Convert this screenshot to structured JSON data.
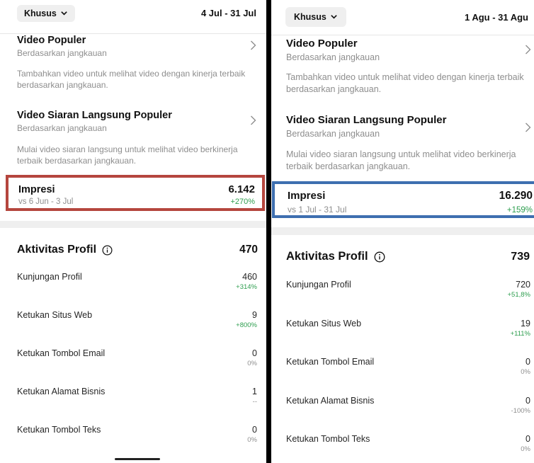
{
  "left": {
    "filter_label": "Khusus",
    "date_range": "4 Jul - 31 Jul",
    "video_populer": {
      "title": "Video Populer",
      "subtitle": "Berdasarkan jangkauan",
      "desc": "Tambahkan video untuk melihat video dengan kinerja terbaik berdasarkan jangkauan."
    },
    "live_populer": {
      "title": "Video Siaran Langsung Populer",
      "subtitle": "Berdasarkan jangkauan",
      "desc": "Mulai video siaran langsung untuk melihat video berkinerja terbaik berdasarkan jangkauan."
    },
    "impresi": {
      "label": "Impresi",
      "value": "6.142",
      "compare": "vs 6 Jun - 3 Jul",
      "change": "+270%",
      "highlight_color": "#b5463e"
    },
    "activity": {
      "title": "Aktivitas Profil",
      "total": "470",
      "metrics": [
        {
          "name": "Kunjungan Profil",
          "value": "460",
          "delta": "+314%",
          "positive": true
        },
        {
          "name": "Ketukan Situs Web",
          "value": "9",
          "delta": "+800%",
          "positive": true
        },
        {
          "name": "Ketukan Tombol Email",
          "value": "0",
          "delta": "0%",
          "positive": false
        },
        {
          "name": "Ketukan Alamat Bisnis",
          "value": "1",
          "delta": "--",
          "positive": false
        },
        {
          "name": "Ketukan Tombol Teks",
          "value": "0",
          "delta": "0%",
          "positive": false
        }
      ]
    }
  },
  "right": {
    "filter_label": "Khusus",
    "date_range": "1 Agu - 31 Agu",
    "video_populer": {
      "title": "Video Populer",
      "subtitle": "Berdasarkan jangkauan",
      "desc": "Tambahkan video untuk melihat video dengan kinerja terbaik berdasarkan jangkauan."
    },
    "live_populer": {
      "title": "Video Siaran Langsung Populer",
      "subtitle": "Berdasarkan jangkauan",
      "desc": "Mulai video siaran langsung untuk melihat video berkinerja terbaik berdasarkan jangkauan."
    },
    "impresi": {
      "label": "Impresi",
      "value": "16.290",
      "compare": "vs 1 Jul - 31 Jul",
      "change": "+159%",
      "highlight_color": "#3e6fb0"
    },
    "activity": {
      "title": "Aktivitas Profil",
      "total": "739",
      "metrics": [
        {
          "name": "Kunjungan Profil",
          "value": "720",
          "delta": "+51,8%",
          "positive": true
        },
        {
          "name": "Ketukan Situs Web",
          "value": "19",
          "delta": "+111%",
          "positive": true
        },
        {
          "name": "Ketukan Tombol Email",
          "value": "0",
          "delta": "0%",
          "positive": false
        },
        {
          "name": "Ketukan Alamat Bisnis",
          "value": "0",
          "delta": "-100%",
          "positive": false
        },
        {
          "name": "Ketukan Tombol Teks",
          "value": "0",
          "delta": "0%",
          "positive": false
        }
      ]
    }
  }
}
